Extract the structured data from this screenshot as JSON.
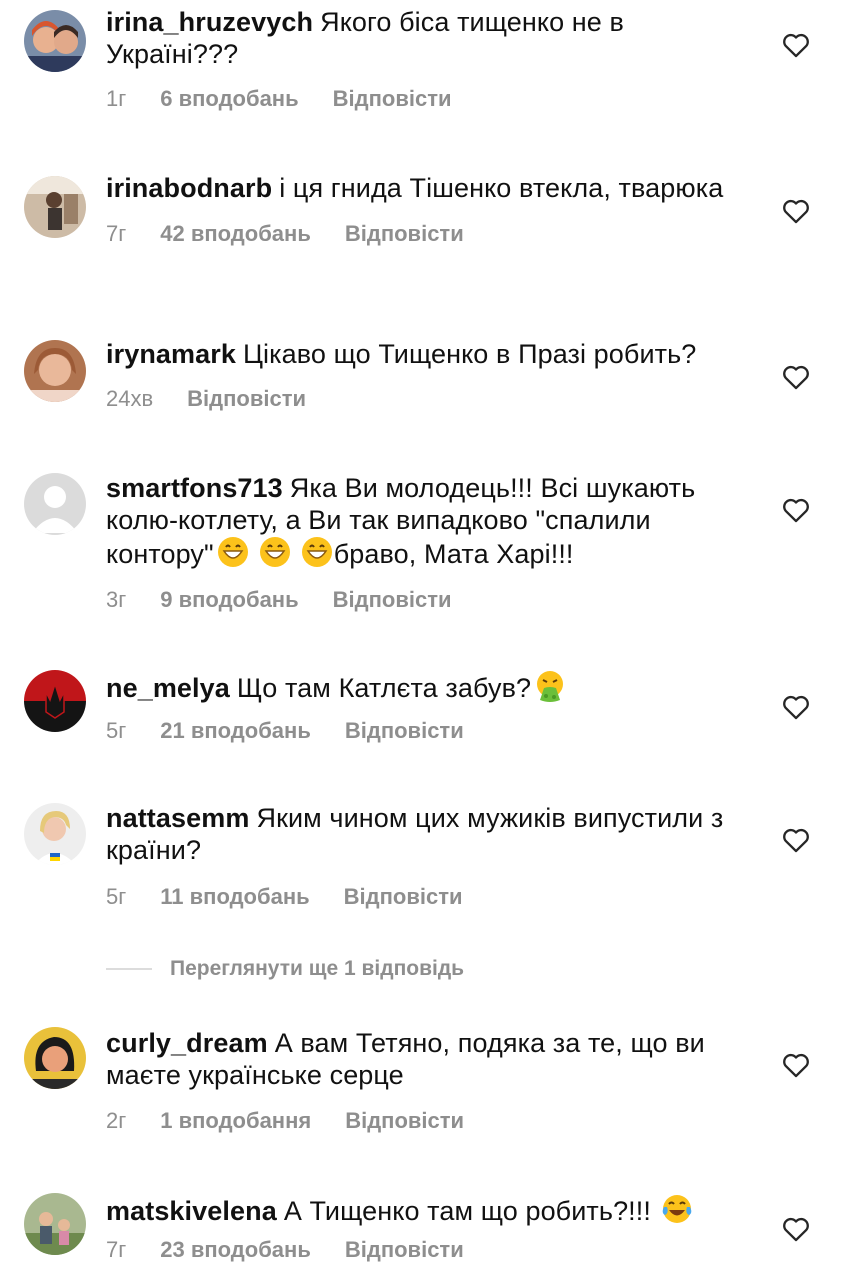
{
  "comments": [
    {
      "username": "irina_hruzevych",
      "text": "Якого біса тищенко не в Україні???",
      "time": "1г",
      "likes": "6 вподобань",
      "reply": "Відповісти",
      "avatar_color": "#c44a3a"
    },
    {
      "username": "irinabodnarb",
      "text": "і ця гнида Тішенко втекла, тварюка",
      "time": "7г",
      "likes": "42 вподобань",
      "reply": "Відповісти",
      "avatar_color": "#b89a80"
    },
    {
      "username": "irynamark",
      "text": "Цікаво що Тищенко в Празі робить?",
      "time": "24хв",
      "likes": "",
      "reply": "Відповісти",
      "avatar_color": "#c48a62"
    },
    {
      "username": "smartfons713",
      "text": "Яка Ви молодець!!! Всі шукають колю-котлету, а Ви так випадково \"спалили контору\"",
      "text_after": "браво, Мата Харі!!!",
      "time": "3г",
      "likes": "9 вподобань",
      "reply": "Відповісти",
      "avatar_color": "#dbdbdb"
    },
    {
      "username": "ne_melya",
      "text": "Що там Катлєта забув?",
      "time": "5г",
      "likes": "21 вподобань",
      "reply": "Відповісти",
      "avatar_color": "#1b1b1b"
    },
    {
      "username": "nattasemm",
      "text": "Яким чином цих  мужиків випустили з країни?",
      "time": "5г",
      "likes": "11 вподобань",
      "reply": "Відповісти",
      "avatar_color": "#e7dccf"
    },
    {
      "username": "curly_dream",
      "text": "А вам Тетяно, подяка за те, що ви маєте українське серце",
      "time": "2г",
      "likes": "1 вподобання",
      "reply": "Відповісти",
      "avatar_color": "#e9c13a"
    },
    {
      "username": "matskivelena",
      "text": "А Тищенко там що робить?!!!",
      "time": "7г",
      "likes": "23 вподобань",
      "reply": "Відповісти",
      "avatar_color": "#8fa37a"
    }
  ],
  "more_replies": "Переглянути ще 1 відповідь",
  "icons": {
    "heart": "heart-outline-icon",
    "grin": "grinning-face-emoji",
    "vomit": "vomiting-face-emoji",
    "laugh": "tears-of-joy-emoji"
  }
}
